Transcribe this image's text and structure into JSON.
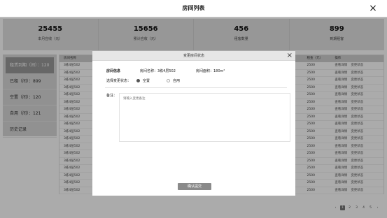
{
  "window": {
    "title": "房间列表",
    "close_icon": "×"
  },
  "stats": [
    {
      "value": "25455",
      "label": "本月应收（元）"
    },
    {
      "value": "15656",
      "label": "累计应收（元）"
    },
    {
      "value": "456",
      "label": "租客数量"
    },
    {
      "value": "899",
      "label": "到期租客"
    }
  ],
  "sidebar": {
    "items": [
      {
        "label": "租赁到期（间）：120"
      },
      {
        "label": "已租（间）：899"
      },
      {
        "label": "空置（间）：120"
      },
      {
        "label": "自用（间）：121"
      },
      {
        "label": "历史记录"
      }
    ]
  },
  "table": {
    "headers": {
      "name": "房间名称",
      "rent": "租金（元）",
      "op": "操作"
    },
    "rows": [
      {
        "name": "3栋4层502",
        "rent": "2500",
        "detail": "查看详情",
        "change": "变更状态"
      },
      {
        "name": "3栋4层502",
        "rent": "2500",
        "detail": "查看详情",
        "change": "变更状态"
      },
      {
        "name": "3栋4层502",
        "rent": "2500",
        "detail": "查看详情",
        "change": "变更状态"
      },
      {
        "name": "3栋4层502",
        "rent": "2500",
        "detail": "查看详情",
        "change": "变更状态"
      },
      {
        "name": "3栋4层502",
        "rent": "2500",
        "detail": "查看详情",
        "change": "变更状态"
      },
      {
        "name": "3栋4层502",
        "rent": "2500",
        "detail": "查看详情",
        "change": "变更状态"
      },
      {
        "name": "3栋4层502",
        "rent": "2500",
        "detail": "查看详情",
        "change": "变更状态"
      },
      {
        "name": "3栋4层502",
        "rent": "2500",
        "detail": "查看详情",
        "change": "变更状态"
      },
      {
        "name": "3栋4层502",
        "rent": "2500",
        "detail": "查看详情",
        "change": "变更状态"
      },
      {
        "name": "3栋4层502",
        "rent": "2500",
        "detail": "查看详情",
        "change": "变更状态"
      },
      {
        "name": "3栋4层502",
        "rent": "2500",
        "detail": "查看详情",
        "change": "变更状态"
      },
      {
        "name": "3栋4层502",
        "rent": "2500",
        "detail": "查看详情",
        "change": "变更状态"
      },
      {
        "name": "3栋4层502",
        "rent": "2500",
        "detail": "查看详情",
        "change": "变更状态"
      },
      {
        "name": "3栋4层502",
        "rent": "2500",
        "detail": "查看详情",
        "change": "变更状态"
      },
      {
        "name": "3栋4层502",
        "rent": "2500",
        "detail": "查看详情",
        "change": "变更状态"
      },
      {
        "name": "3栋4层502",
        "rent": "2500",
        "detail": "查看详情",
        "change": "变更状态"
      },
      {
        "name": "3栋4层502",
        "rent": "2500",
        "detail": "查看详情",
        "change": "变更状态"
      },
      {
        "name": "3栋4层502",
        "rent": "2500",
        "detail": "查看详情",
        "change": "变更状态"
      }
    ]
  },
  "pagination": {
    "prev": "‹",
    "pages": [
      "1",
      "2",
      "3",
      "4",
      "5"
    ],
    "next": "›"
  },
  "dialog": {
    "title": "变更房间状态",
    "close_icon": "×",
    "info_heading": "房间信息",
    "room_name": "房间名称：3栋4层502",
    "room_area": "房间面积：180m²",
    "status_label": "选择变更状态：",
    "options": [
      "空置",
      "自用"
    ],
    "remark_label": "备注：",
    "remark_placeholder": "请输入变更备注",
    "confirm": "确认提交"
  }
}
